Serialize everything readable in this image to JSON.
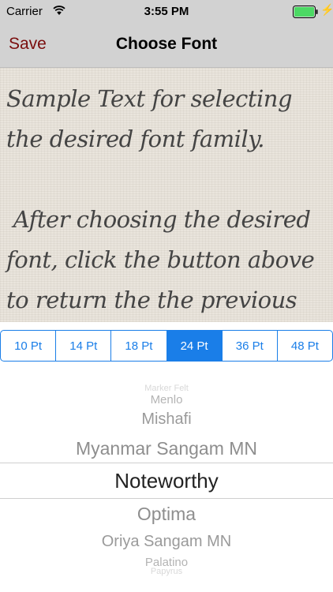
{
  "status_bar": {
    "carrier": "Carrier",
    "time": "3:55 PM",
    "battery_color": "#4cd964"
  },
  "nav": {
    "save_label": "Save",
    "title": "Choose Font",
    "save_color": "#7a0d0d"
  },
  "sample": {
    "text": "Sample Text for selecting the desired font family.\n\n After choosing the desired font, click the button above to return the the previous readings using"
  },
  "sizes": {
    "options": [
      "10 Pt",
      "14 Pt",
      "18 Pt",
      "24 Pt",
      "36 Pt",
      "48 Pt"
    ],
    "selected": "24 Pt",
    "accent_color": "#1a7ee8"
  },
  "picker": {
    "items": [
      "Marker Felt",
      "Menlo",
      "Mishafi",
      "Myanmar Sangam MN",
      "Noteworthy",
      "Optima",
      "Oriya Sangam MN",
      "Palatino",
      "Papyrus"
    ],
    "selected": "Noteworthy"
  }
}
